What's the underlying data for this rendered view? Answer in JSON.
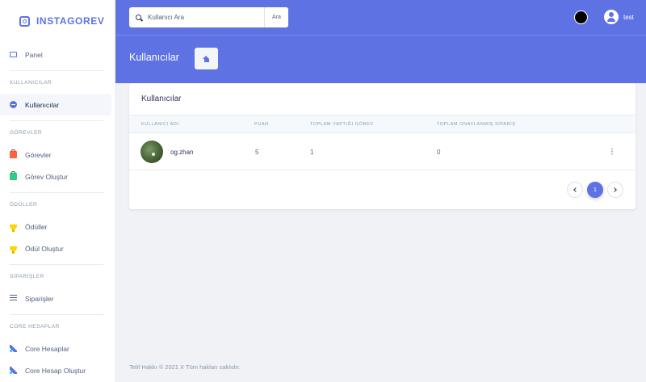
{
  "brand": {
    "name": "INSTAGOREV"
  },
  "sidebar": {
    "panel": {
      "label": "Panel"
    },
    "sections": [
      {
        "title": "KULLANICILAR",
        "items": [
          {
            "label": "Kullanıcılar",
            "icon": "user-circle-icon"
          }
        ]
      },
      {
        "title": "GÖREVLER",
        "items": [
          {
            "label": "Görevler",
            "icon": "briefcase-icon"
          },
          {
            "label": "Görev Oluştur",
            "icon": "briefcase-add-icon"
          }
        ]
      },
      {
        "title": "ÖDÜLLER",
        "items": [
          {
            "label": "Ödüller",
            "icon": "trophy-icon"
          },
          {
            "label": "Ödül Oluştur",
            "icon": "trophy-add-icon"
          }
        ]
      },
      {
        "title": "SİPARİŞLER",
        "items": [
          {
            "label": "Siparişler",
            "icon": "list-icon"
          }
        ]
      },
      {
        "title": "CORE HESAPLAR",
        "items": [
          {
            "label": "Core Hesaplar",
            "icon": "rocket-icon"
          },
          {
            "label": "Core Hesap Oluştur",
            "icon": "rocket-add-icon"
          }
        ]
      }
    ]
  },
  "header": {
    "search": {
      "placeholder": "Kullanıcı Ara",
      "button_label": "Ara"
    },
    "user": {
      "name": "test"
    },
    "page_title": "Kullanıcılar"
  },
  "card": {
    "title": "Kullanıcılar",
    "columns": [
      "KULLANICI ADI",
      "PUAN",
      "TOPLAM YAPTIĞI GÖREV",
      "TOPLAM ONAYLANMIŞ SİPARİŞ"
    ],
    "rows": [
      {
        "username": "og.zhan",
        "points": "5",
        "tasks": "1",
        "orders": "0"
      }
    ],
    "pagination": {
      "current": "1"
    }
  },
  "footer": {
    "text": "Telif Hakkı © 2021 X Tüm hakları saklıdır."
  },
  "colors": {
    "accent": "#5e72e4",
    "background": "#f1f2f6"
  }
}
